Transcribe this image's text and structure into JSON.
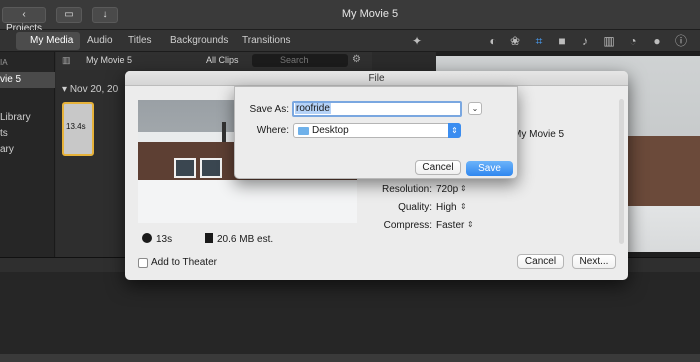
{
  "app": {
    "window_title": "My Movie 5",
    "projects_label": "Projects"
  },
  "tabs": [
    "My Media",
    "Audio",
    "Titles",
    "Backgrounds",
    "Transitions"
  ],
  "sidebar": {
    "items": [
      "IA",
      "vie 5",
      "Library",
      "ts",
      "ary"
    ]
  },
  "browser": {
    "project_name": "My Movie 5",
    "filter": "All Clips",
    "search_placeholder": "Search",
    "date_header": "Nov 20, 20",
    "clip_duration": "13.4s"
  },
  "sheet": {
    "title": "File",
    "project_name": "My Movie 5",
    "duration": "13s",
    "size": "20.6 MB est.",
    "options": [
      {
        "label": "Resolution:",
        "value": "720p"
      },
      {
        "label": "Quality:",
        "value": "High"
      },
      {
        "label": "Compress:",
        "value": "Faster"
      }
    ],
    "add_to_theater": "Add to Theater",
    "cancel_label": "Cancel",
    "next_label": "Next..."
  },
  "save_dialog": {
    "save_as_label": "Save As:",
    "save_as_value": "roofride",
    "where_label": "Where:",
    "where_value": "Desktop",
    "cancel_label": "Cancel",
    "save_label": "Save"
  },
  "colors": {
    "accent": "#2f86ef",
    "clip_border": "#e6b23a"
  }
}
